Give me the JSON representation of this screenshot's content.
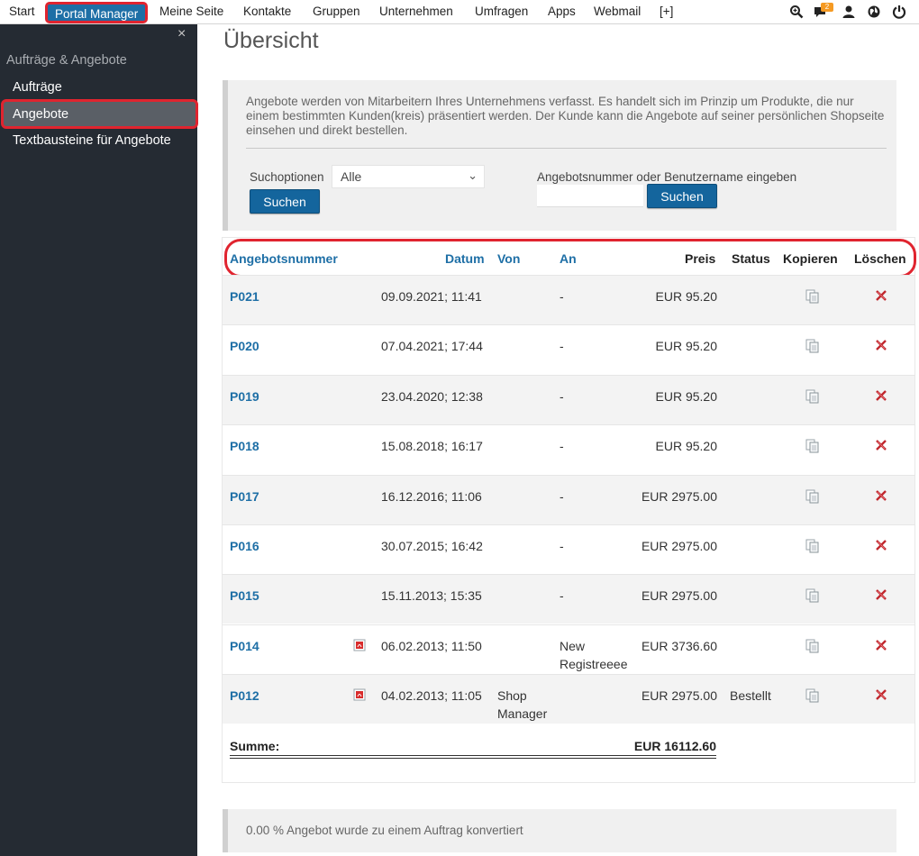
{
  "topnav": {
    "items": [
      "Start",
      "Portal Manager",
      "Meine Seite",
      "Kontakte",
      "Gruppen",
      "Unternehmen",
      "Umfragen",
      "Apps",
      "Webmail",
      "[+]"
    ],
    "notification_count": "2",
    "icons": [
      "search-icon",
      "chat-icon",
      "user-icon",
      "globe-icon",
      "power-icon"
    ]
  },
  "sidebar": {
    "close": "×",
    "section_title": "Aufträge & Angebote",
    "items": [
      "Aufträge",
      "Angebote",
      "Textbausteine für Angebote"
    ]
  },
  "main": {
    "title": "Übersicht",
    "info_text": "Angebote werden von Mitarbeitern Ihres Unternehmens verfasst. Es handelt sich im Prinzip um Produkte, die nur einem bestimmten Kunden(kreis) präsentiert werden. Der Kunde kann die Angebote auf seiner persönlichen Shopseite einsehen und direkt bestellen.",
    "search": {
      "options_label": "Suchoptionen",
      "select_value": "Alle",
      "button_label": "Suchen",
      "number_label": "Angebotsnummer oder Benutzername eingeben",
      "number_value": "",
      "number_button_label": "Suchen"
    },
    "table": {
      "headers": [
        "Angebotsnummer",
        "Datum",
        "Von",
        "An",
        "Preis",
        "Status",
        "Kopieren",
        "Löschen"
      ],
      "rows": [
        {
          "id": "P021",
          "pdf": false,
          "date": "09.09.2021; 11:41",
          "von": "",
          "an": "-",
          "price": "EUR 95.20",
          "status": ""
        },
        {
          "id": "P020",
          "pdf": false,
          "date": "07.04.2021; 17:44",
          "von": "",
          "an": "-",
          "price": "EUR 95.20",
          "status": ""
        },
        {
          "id": "P019",
          "pdf": false,
          "date": "23.04.2020; 12:38",
          "von": "",
          "an": "-",
          "price": "EUR 95.20",
          "status": ""
        },
        {
          "id": "P018",
          "pdf": false,
          "date": "15.08.2018; 16:17",
          "von": "",
          "an": "-",
          "price": "EUR 95.20",
          "status": ""
        },
        {
          "id": "P017",
          "pdf": false,
          "date": "16.12.2016; 11:06",
          "von": "",
          "an": "-",
          "price": "EUR 2975.00",
          "status": ""
        },
        {
          "id": "P016",
          "pdf": false,
          "date": "30.07.2015; 16:42",
          "von": "",
          "an": "-",
          "price": "EUR 2975.00",
          "status": ""
        },
        {
          "id": "P015",
          "pdf": false,
          "date": "15.11.2013; 15:35",
          "von": "",
          "an": "-",
          "price": "EUR 2975.00",
          "status": ""
        },
        {
          "id": "P014",
          "pdf": true,
          "date": "06.02.2013; 11:50",
          "von": "",
          "an": "New\nRegistreeee",
          "price": "EUR 3736.60",
          "status": ""
        },
        {
          "id": "P012",
          "pdf": true,
          "date": "04.02.2013; 11:05",
          "von": "Shop\nManager",
          "an": "",
          "price": "EUR 2975.00",
          "status": "Bestellt"
        }
      ],
      "sum_label": "Summe:",
      "sum_value": "EUR 16112.60"
    },
    "footer_text": "0.00 % Angebot wurde zu einem Auftrag konvertiert"
  },
  "colors": {
    "accent": "#1e6fa6",
    "highlight": "#e0242f",
    "sidebar_bg": "#252b33",
    "delete": "#c0272d"
  }
}
